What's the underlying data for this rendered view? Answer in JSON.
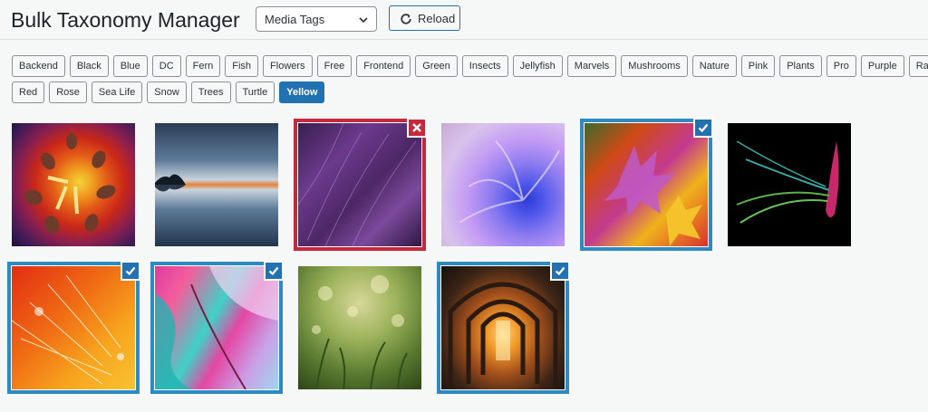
{
  "header": {
    "title": "Bulk Taxonomy Manager",
    "taxonomy_select": {
      "value": "Media Tags"
    },
    "reload_label": "Reload"
  },
  "tags": [
    [
      "Backend",
      "Black",
      "Blue",
      "DC",
      "Fern",
      "Fish",
      "Flowers",
      "Free",
      "Frontend",
      "Green",
      "Insects",
      "Jellyfish",
      "Marvels",
      "Mushrooms",
      "Nature",
      "Pink",
      "Plants",
      "Pro",
      "Purple",
      "Rainbow"
    ],
    [
      "Red",
      "Rose",
      "Sea Life",
      "Snow",
      "Trees",
      "Turtle",
      "Yellow"
    ]
  ],
  "active_tag": "Yellow",
  "colors": {
    "accent": "#2271b1",
    "selected_border": "#2e8bc2",
    "excluded_border": "#c8283b"
  },
  "media": [
    {
      "name": "flower-stamens",
      "state": "selected"
    },
    {
      "name": "sunset-reflection",
      "state": "none"
    },
    {
      "name": "purple-feathers",
      "state": "excluded"
    },
    {
      "name": "purple-chrysanthemum",
      "state": "none"
    },
    {
      "name": "autumn-leaves",
      "state": "selected"
    },
    {
      "name": "lily-on-black",
      "state": "none"
    },
    {
      "name": "dandelion-orange",
      "state": "selected"
    },
    {
      "name": "alcohol-ink",
      "state": "selected"
    },
    {
      "name": "dewy-grass",
      "state": "none"
    },
    {
      "name": "arched-corridor",
      "state": "selected"
    }
  ]
}
